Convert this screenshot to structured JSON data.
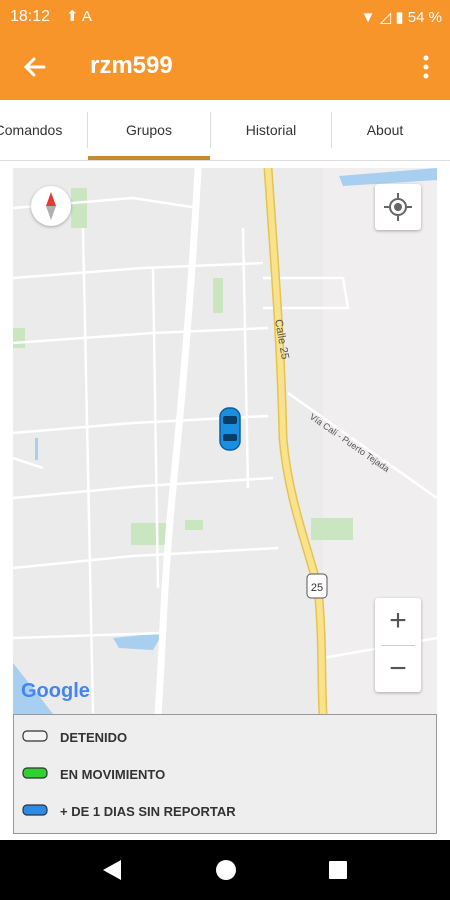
{
  "status": {
    "time": "18:12",
    "battery": "54 %",
    "icons": "⬆ A"
  },
  "app": {
    "title": "rzm599"
  },
  "tabs": [
    {
      "label": "Comandos"
    },
    {
      "label": "Grupos"
    },
    {
      "label": "Historial"
    },
    {
      "label": "About"
    }
  ],
  "map": {
    "road_label1": "Calle 25",
    "road_label2": "Vía Cali - Puerto Tejada",
    "shield": "25",
    "logo": "Google",
    "zoom_in": "+",
    "zoom_out": "−"
  },
  "legend": [
    {
      "label": "DETENIDO",
      "color": "#f3f3f3"
    },
    {
      "label": "EN MOVIMIENTO",
      "color": "#2ed12e"
    },
    {
      "label": "+ DE 1 DIAS SIN REPORTAR",
      "color": "#2b8be6"
    }
  ]
}
